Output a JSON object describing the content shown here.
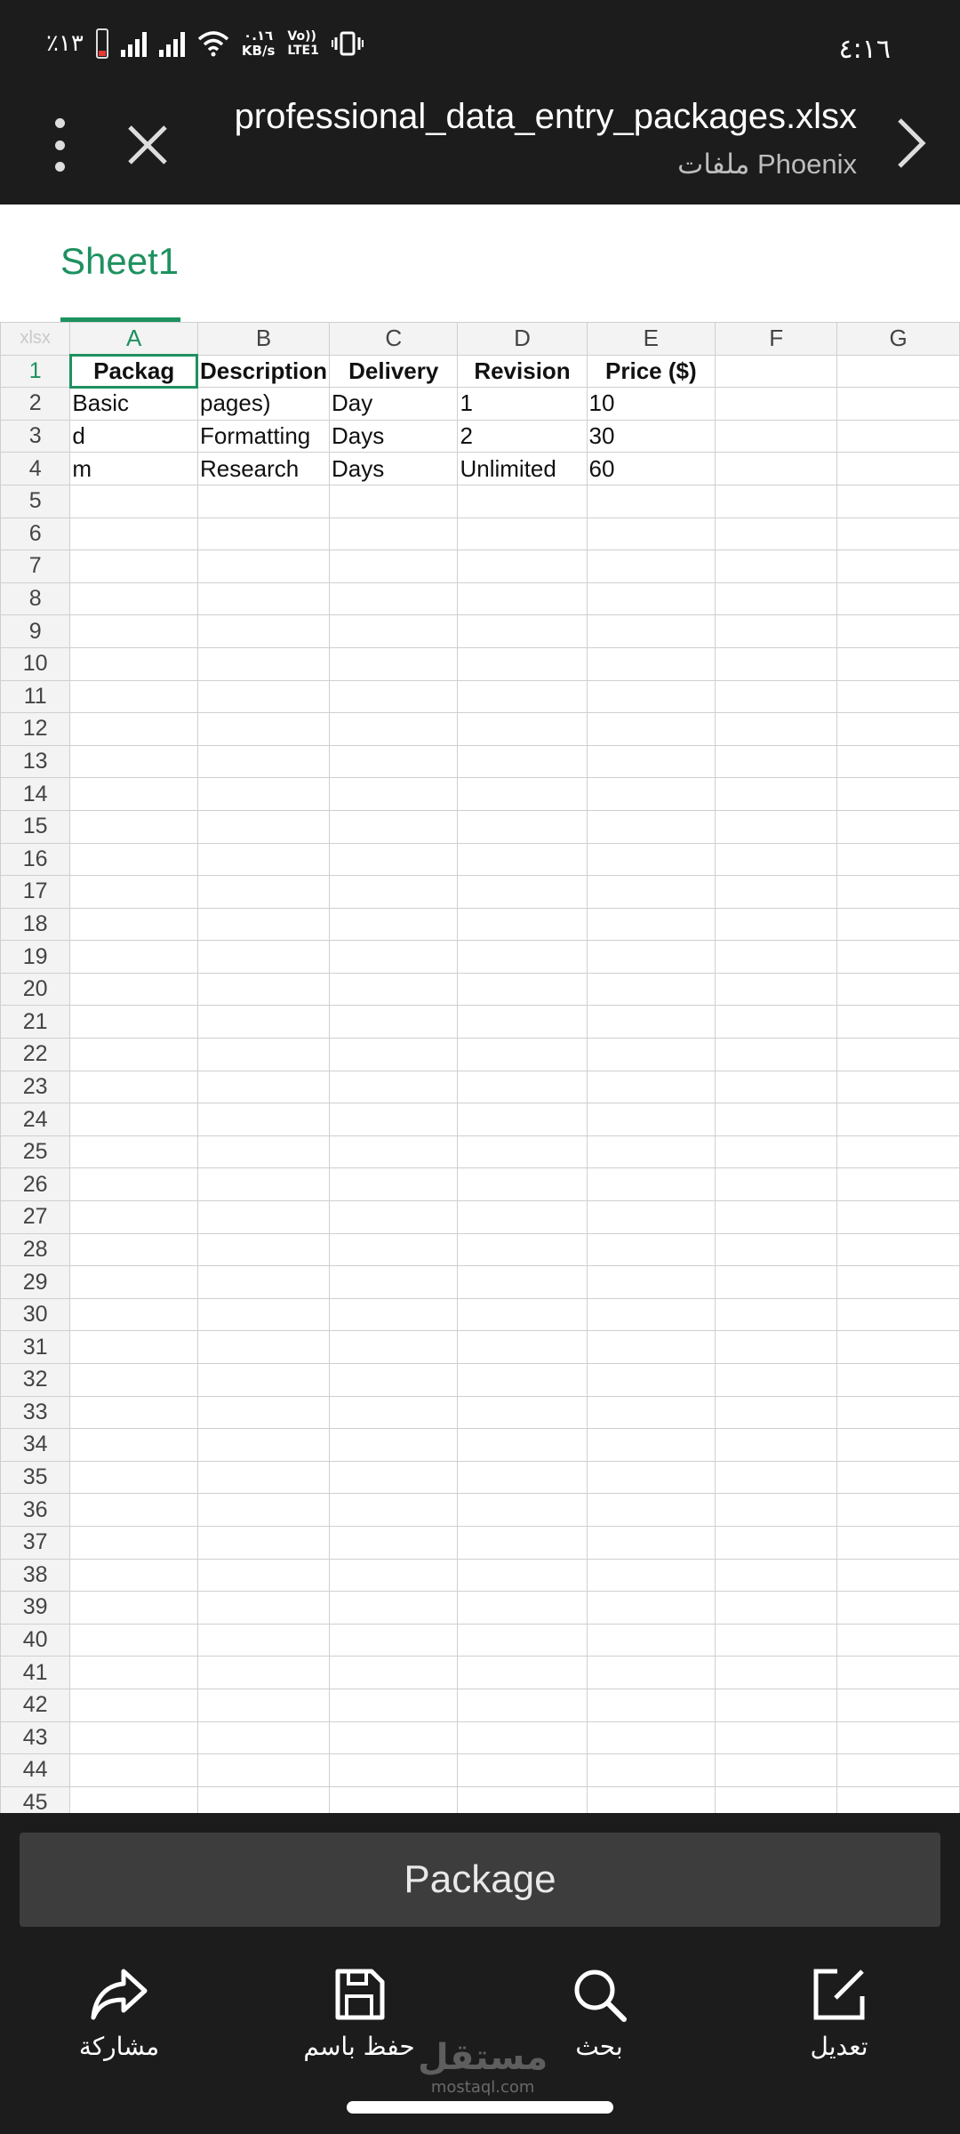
{
  "status_bar": {
    "battery_text": "٪١٣",
    "net_speed_value": "٠.١٦",
    "net_speed_unit": "KB/s",
    "volte_top": "Vo))",
    "volte_bottom": "LTE1",
    "time": "٤:١٦"
  },
  "toolbar": {
    "file_name": "professional_data_entry_packages.xlsx",
    "subtitle": "ملفات Phoenix"
  },
  "sheet": {
    "tab_label": "Sheet1",
    "corner_label": "xlsx"
  },
  "grid": {
    "columns": [
      "A",
      "B",
      "C",
      "D",
      "E",
      "F",
      "G"
    ],
    "active_column": "A",
    "active_row": "1",
    "rows": [
      [
        "Packag",
        "Description",
        "Delivery",
        "Revision",
        "Price ($)",
        "",
        ""
      ],
      [
        "Basic",
        "pages)",
        "Day",
        "1",
        "10",
        "",
        ""
      ],
      [
        "d",
        "Formatting",
        "Days",
        "2",
        "30",
        "",
        ""
      ],
      [
        "m",
        "Research",
        "Days",
        "Unlimited",
        "60",
        "",
        ""
      ]
    ],
    "row_count": 45
  },
  "input_bar": {
    "cell_value": "Package"
  },
  "bottom_nav": {
    "share": "مشاركة",
    "save_as": "حفظ باسم",
    "search": "بحث",
    "edit": "تعديل"
  },
  "watermark": {
    "arabic": "مستقل",
    "latin": "mostaql.com"
  }
}
